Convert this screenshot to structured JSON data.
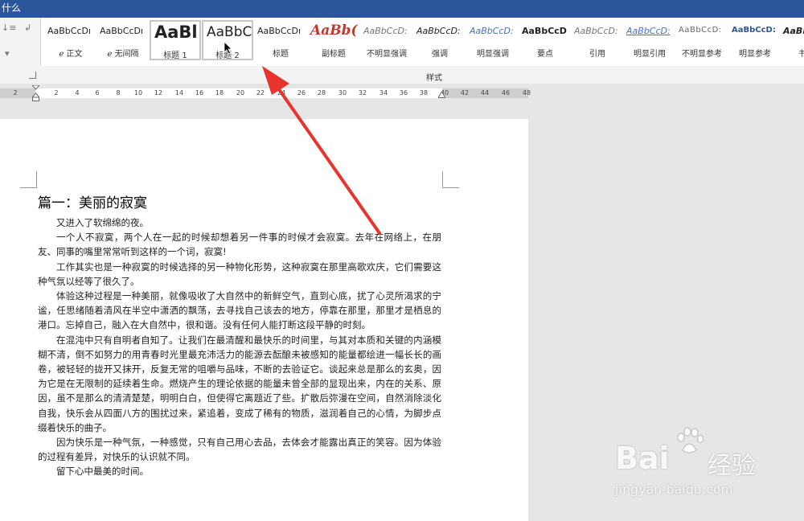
{
  "app": {
    "titlebar_text": "什么"
  },
  "styles_gallery": {
    "group_label": "样式",
    "items": [
      {
        "preview": "AaBbCcDı",
        "name": "ℯ 正文"
      },
      {
        "preview": "AaBbCcDı",
        "name": "ℯ 无间隔"
      },
      {
        "preview": "AaBl",
        "name": "标题 1"
      },
      {
        "preview": "AaBbC",
        "name": "标题 2"
      },
      {
        "preview": "AaBbCcDı",
        "name": "标题"
      },
      {
        "preview": "AaBb(",
        "name": "副标题"
      },
      {
        "preview": "AaBbCcD:",
        "name": "不明显强调"
      },
      {
        "preview": "AaBbCcD:",
        "name": "强调"
      },
      {
        "preview": "AaBbCcD:",
        "name": "明显强调"
      },
      {
        "preview": "AaBbCcD",
        "name": "要点"
      },
      {
        "preview": "AaBbCcD:",
        "name": "引用"
      },
      {
        "preview": "AaBbCcD:",
        "name": "明显引用"
      },
      {
        "preview": "AaBbCcD:",
        "name": "不明显参考"
      },
      {
        "preview": "AaBbCcD:",
        "name": "明显参考"
      },
      {
        "preview": "AaBb",
        "name": "书籍"
      }
    ]
  },
  "ruler": {
    "ticks": [
      "2",
      "2",
      "4",
      "6",
      "8",
      "10",
      "12",
      "14",
      "16",
      "18",
      "20",
      "22",
      "24",
      "26",
      "28",
      "30",
      "32",
      "34",
      "36",
      "38",
      "40",
      "42",
      "44",
      "46",
      "48"
    ]
  },
  "document": {
    "heading": "篇一：美丽的寂寞",
    "paragraphs": [
      "又进入了软绵绵的夜。",
      "一个人不寂寞，两个人在一起的时候却想着另一件事的时候才会寂寞。去年在网络上，在朋友、同事的嘴里常常听到这样的一个词，寂寞!",
      "工作其实也是一种寂寞的时候选择的另一种物化形势，这种寂寞在那里高歌欢庆，它们需要这种气氛以经等了很久了。",
      "体验这种过程是一种美丽，就像吸收了大自然中的新鲜空气，直到心底，扰了心灵所渴求的宁谧，任思绪随着清风在半空中潇洒的飘荡，去寻找自己该去的地方，停靠在那里，那里才是栖息的港口。忘掉自己，融入在大自然中，很和谐。没有任何人能打断这段平静的时刻。",
      "在混沌中只有自明者自知了。让我们在最清醒和最快乐的时间里，与其对本质和关键的内涵模糊不清，倒不如努力的用青春时光里最充沛活力的能源去酝酿未被感知的能量都绘进一幅长长的画卷，被轻轻的拢开又抹开，反复无常的咀嚼与品味，不断的去验证它。谈起来总是那么的玄奥，因为它是在无限制的延续着生命。燃烧产生的理论依据的能量未曾全部的显现出来，内在的关系、原因，虽不是那么的清清楚楚，明明白白，但使得它离题近了些。扩散后弥漫在空间，自然消除淡化自我，快乐会从四面八方的围扰过来，紧追着，变成了稀有的物质，滋润着自己的心情，为脚步点缀着快乐的曲子。",
      "因为快乐是一种气氛，一种感觉，只有自己用心去品，去体会才能露出真正的笑容。因为体验的过程有差异，对快乐的认识就不同。",
      "留下心中最美的时间。"
    ]
  },
  "watermark": {
    "brand": "Bai",
    "brand_suffix": "经验",
    "url": "jingyan.baidu.com"
  },
  "colors": {
    "titlebar": "#2b579a",
    "arrow": "#e8342c"
  }
}
